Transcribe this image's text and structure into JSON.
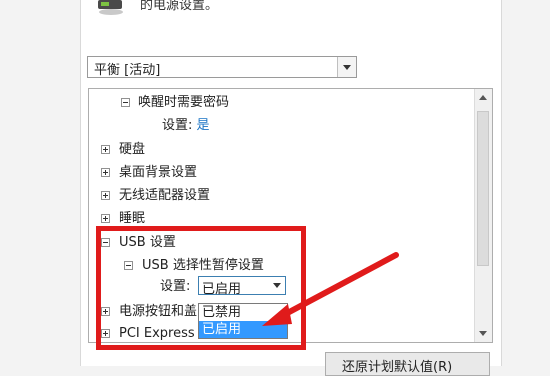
{
  "intro_text": "的电源设置。",
  "plan_select": {
    "value": "平衡 [活动]"
  },
  "tree": {
    "items": [
      {
        "label": "唤醒时需要密码"
      },
      {
        "label": "设置:",
        "value": "是"
      },
      {
        "label": "硬盘"
      },
      {
        "label": "桌面背景设置"
      },
      {
        "label": "无线适配器设置"
      },
      {
        "label": "睡眠"
      },
      {
        "label": "USB 设置"
      },
      {
        "label": "USB 选择性暂停设置"
      },
      {
        "label": "设置:"
      },
      {
        "label": "电源按钮和盖"
      },
      {
        "label": "PCI Express"
      }
    ]
  },
  "setting_dropdown": {
    "current": "已启用",
    "options": [
      "已禁用",
      "已启用"
    ],
    "selected_index": 1
  },
  "restore_button": {
    "label": "还原计划默认值(R)"
  },
  "colors": {
    "highlight": "#3399ff",
    "annotation": "#e01b1b",
    "value_link": "#1b74c5"
  }
}
